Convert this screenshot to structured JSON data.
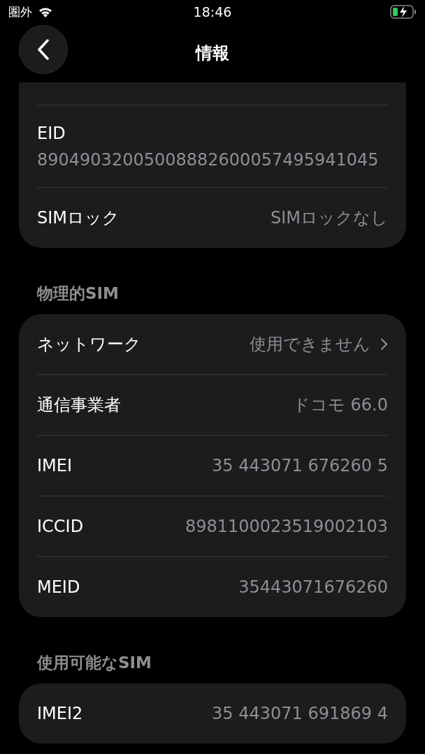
{
  "status_bar": {
    "carrier": "圏外",
    "time": "18:46"
  },
  "nav": {
    "title": "情報"
  },
  "sections": [
    {
      "cut_top": true,
      "rows": [
        {
          "kind": "stacked",
          "label": "EID",
          "value": "89049032005008882600057495941045"
        },
        {
          "kind": "value",
          "label": "SIMロック",
          "value": "SIMロックなし"
        }
      ]
    },
    {
      "header": "物理的SIM",
      "rows": [
        {
          "kind": "link",
          "label": "ネットワーク",
          "value": "使用できません"
        },
        {
          "kind": "value",
          "label": "通信事業者",
          "value": "ドコモ 66.0"
        },
        {
          "kind": "value",
          "label": "IMEI",
          "value": "35 443071 676260 5"
        },
        {
          "kind": "value",
          "label": "ICCID",
          "value": "8981100023519002103"
        },
        {
          "kind": "value",
          "label": "MEID",
          "value": "35443071676260"
        }
      ]
    },
    {
      "header": "使用可能なSIM",
      "rows": [
        {
          "kind": "value",
          "label": "IMEI2",
          "value": "35 443071 691869 4"
        }
      ]
    }
  ]
}
